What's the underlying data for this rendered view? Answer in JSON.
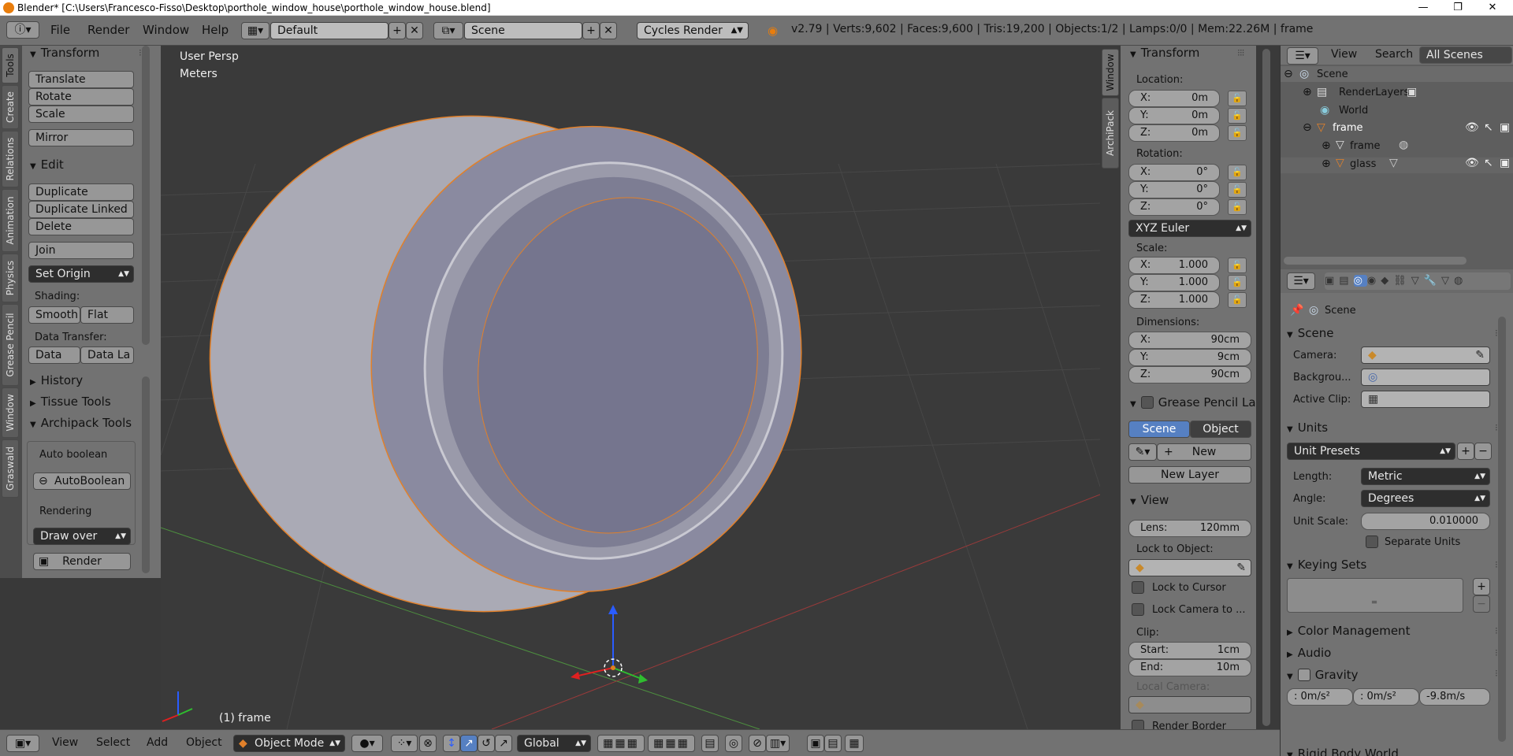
{
  "titlebar": {
    "title": "Blender* [C:\\Users\\Francesco-Fisso\\Desktop\\porthole_window_house\\porthole_window_house.blend]",
    "min": "—",
    "max": "❐",
    "close": "✕"
  },
  "topbar": {
    "menus": [
      "File",
      "Render",
      "Window",
      "Help"
    ],
    "layout": "Default",
    "scene": "Scene",
    "engine": "Cycles Render",
    "stats": "v2.79 | Verts:9,602 | Faces:9,600 | Tris:19,200 | Objects:1/2 | Lamps:0/0 | Mem:22.26M | frame"
  },
  "left_tabs": [
    "Tools",
    "Create",
    "Relations",
    "Animation",
    "Physics",
    "Grease Pencil",
    "Window",
    "Graswald"
  ],
  "tools": {
    "transform_header": "Transform",
    "translate": "Translate",
    "rotate": "Rotate",
    "scale": "Scale",
    "mirror": "Mirror",
    "edit_header": "Edit",
    "duplicate": "Duplicate",
    "duplicate_linked": "Duplicate Linked",
    "delete": "Delete",
    "join": "Join",
    "set_origin": "Set Origin",
    "shading_label": "Shading:",
    "smooth": "Smooth",
    "flat": "Flat",
    "data_transfer_label": "Data Transfer:",
    "data": "Data",
    "data_la": "Data La",
    "history": "History",
    "tissue": "Tissue Tools",
    "archipack": "Archipack Tools",
    "auto_boolean_label": "Auto boolean",
    "auto_boolean_btn": "AutoBoolean",
    "rendering_label": "Rendering",
    "draw_over": "Draw over",
    "render_btn": "Render"
  },
  "viewport": {
    "view_name": "User Persp",
    "units": "Meters",
    "object_label": "(1) frame"
  },
  "npanel_tabs": [
    "Window",
    "ArchiPack"
  ],
  "npanel": {
    "transform_header": "Transform",
    "location_label": "Location:",
    "rotation_label": "Rotation:",
    "scale_label": "Scale:",
    "dimensions_label": "Dimensions:",
    "location": [
      {
        "k": "X:",
        "v": "0m"
      },
      {
        "k": "Y:",
        "v": "0m"
      },
      {
        "k": "Z:",
        "v": "0m"
      }
    ],
    "rotation": [
      {
        "k": "X:",
        "v": "0°"
      },
      {
        "k": "Y:",
        "v": "0°"
      },
      {
        "k": "Z:",
        "v": "0°"
      }
    ],
    "rotation_mode": "XYZ Euler",
    "scale": [
      {
        "k": "X:",
        "v": "1.000"
      },
      {
        "k": "Y:",
        "v": "1.000"
      },
      {
        "k": "Z:",
        "v": "1.000"
      }
    ],
    "dimensions": [
      {
        "k": "X:",
        "v": "90cm"
      },
      {
        "k": "Y:",
        "v": "9cm"
      },
      {
        "k": "Z:",
        "v": "90cm"
      }
    ],
    "grease_header": "Grease Pencil La",
    "gp_scene": "Scene",
    "gp_object": "Object",
    "gp_new": "New",
    "gp_new_layer": "New Layer",
    "view_header": "View",
    "lens_k": "Lens:",
    "lens_v": "120mm",
    "lock_to_object": "Lock to Object:",
    "lock_cursor": "Lock to Cursor",
    "lock_camera": "Lock Camera to ...",
    "clip_label": "Clip:",
    "clip_start_k": "Start:",
    "clip_start_v": "1cm",
    "clip_end_k": "End:",
    "clip_end_v": "10m",
    "local_camera": "Local Camera:",
    "render_border": "Render Border"
  },
  "outliner": {
    "view": "View",
    "search": "Search",
    "scenes": "All Scenes",
    "items": [
      {
        "label": "Scene"
      },
      {
        "label": "RenderLayers"
      },
      {
        "label": "World"
      },
      {
        "label": "frame"
      },
      {
        "label": "frame"
      },
      {
        "label": "glass"
      }
    ]
  },
  "properties": {
    "breadcrumb": "Scene",
    "scene_header": "Scene",
    "camera": "Camera:",
    "background": "Backgrou...",
    "active_clip": "Active Clip:",
    "units_header": "Units",
    "unit_presets": "Unit Presets",
    "length_k": "Length:",
    "length_v": "Metric",
    "angle_k": "Angle:",
    "angle_v": "Degrees",
    "unit_scale_k": "Unit Scale:",
    "unit_scale_v": "0.010000",
    "separate_units": "Separate Units",
    "keying_sets": "Keying Sets",
    "color_management": "Color Management",
    "audio": "Audio",
    "gravity": "Gravity",
    "grav_x": ": 0m/s²",
    "grav_y": ": 0m/s²",
    "grav_z": "-9.8m/s",
    "rigid_body": "Rigid Body World"
  },
  "bottombar": {
    "view": "View",
    "select": "Select",
    "add": "Add",
    "object": "Object",
    "mode": "Object Mode",
    "orientation": "Global"
  }
}
